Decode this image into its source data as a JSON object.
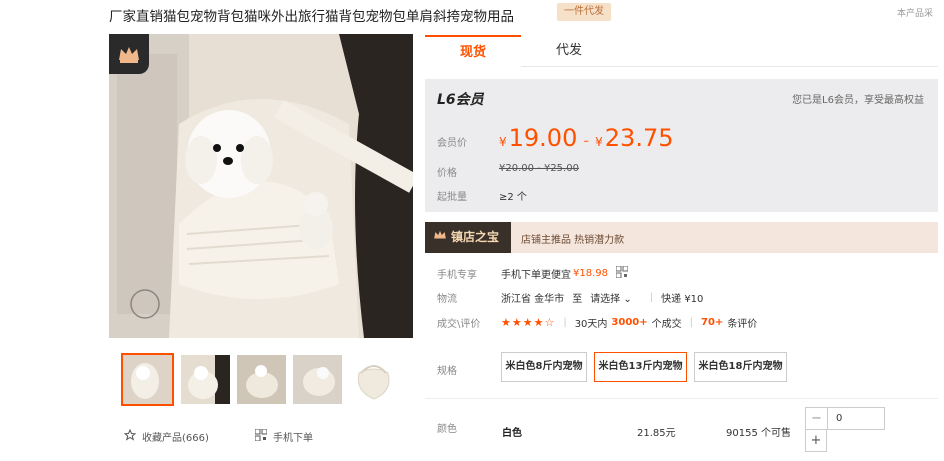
{
  "product": {
    "title": "厂家直销猫包宠物背包猫咪外出旅行猫背包宠物包单肩斜挎宠物用品",
    "badge": "一件代发",
    "corner_note": "本产品采"
  },
  "gallery": {
    "favorite_label": "收藏产品(666)",
    "mobile_order_label": "手机下单"
  },
  "tabs": [
    {
      "label": "现货",
      "active": true
    },
    {
      "label": "代发",
      "active": false
    }
  ],
  "price_box": {
    "level": "L6会员",
    "level_note": "您已是L6会员，享受最高权益",
    "member_price_label": "会员价",
    "currency": "¥",
    "price_low": "19.00",
    "price_sep": "-",
    "price_high": "23.75",
    "orig_label": "价格",
    "orig_price": "¥20.00 - ¥25.00",
    "moq_label": "起批量",
    "moq_value": "≥2 个"
  },
  "treasure": {
    "tag": "镇店之宝",
    "text": "店铺主推品  热销潜力款"
  },
  "rows": {
    "mobile_label": "手机专享",
    "mobile_text": "手机下单更便宜",
    "mobile_price": "¥18.98",
    "logistics_label": "物流",
    "logistics_from": "浙江省 金华市",
    "logistics_to_word": "至",
    "logistics_select": "请选择",
    "logistics_fee": "快递  ¥10",
    "reviews_label": "成交\\评价",
    "rating": 4.5,
    "sales_prefix": "30天内",
    "sales_count": "3000+",
    "sales_suffix": "个成交",
    "review_count": "70+",
    "review_suffix": "条评价"
  },
  "specs": {
    "label": "规格",
    "options": [
      {
        "label": "米白色8斤内宠物",
        "selected": false
      },
      {
        "label": "米白色13斤内宠物",
        "selected": true
      },
      {
        "label": "米白色18斤内宠物",
        "selected": false
      }
    ]
  },
  "colors": {
    "label": "颜色",
    "name": "白色",
    "price": "21.85元",
    "stock": "90155 个可售",
    "quantity": "0",
    "minus": "−",
    "plus": "+"
  },
  "theme": {
    "accent": "#ff5000",
    "price_box_bg": "#ececee",
    "treasure_bg": "#f4e6dd"
  }
}
